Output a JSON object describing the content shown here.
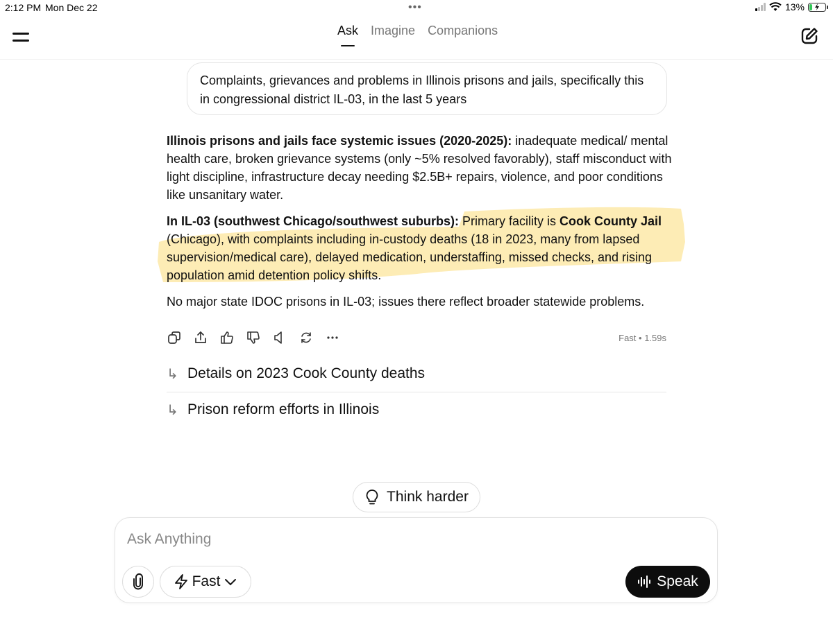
{
  "status_bar": {
    "time": "2:12 PM",
    "date": "Mon Dec 22",
    "battery": "13%"
  },
  "header": {
    "tabs": [
      {
        "label": "Ask",
        "active": true
      },
      {
        "label": "Imagine",
        "active": false
      },
      {
        "label": "Companions",
        "active": false
      }
    ]
  },
  "user_message": "Complaints, grievances and problems in Illinois prisons and jails, specifically this in congressional district IL-03, in the last 5 years",
  "answer": {
    "p1_bold": "Illinois prisons and jails face systemic issues (2020-2025):",
    "p1_text": " inadequate medical/ mental health care, broken grievance systems (only ~5% resolved favorably), staff misconduct with light discipline, infrastructure decay needing $2.5B+ repairs, violence, and poor conditions like unsanitary water.",
    "p2_bold": "In IL-03 (southwest Chicago/southwest suburbs):",
    "p2_text_a": " Primary facility is ",
    "p2_bold2": "Cook County Jail",
    "p2_text_b": " (Chicago), with complaints including in-custody deaths (18 in 2023, many from lapsed supervision/medical care), delayed medication, understaffing, missed checks, and rising population amid detention policy shifts.",
    "p3_text": "No major state IDOC prisons in IL-03; issues there reflect broader statewide problems.",
    "highlight_color": "#fde9a8"
  },
  "meta": "Fast • 1.59s",
  "followups": [
    "Details on 2023 Cook County deaths",
    "Prison reform efforts in Illinois"
  ],
  "think_harder_label": "Think harder",
  "composer": {
    "placeholder": "Ask Anything",
    "model_label": "Fast",
    "speak_label": "Speak"
  }
}
